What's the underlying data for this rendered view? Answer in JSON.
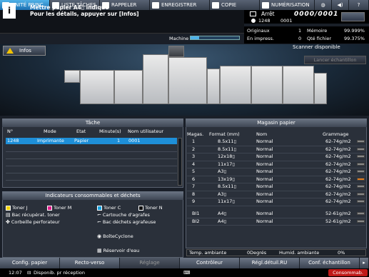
{
  "tabs": [
    {
      "label": "UNITÉ PRINC.",
      "active": true,
      "icon": "home-icon"
    },
    {
      "label": "LISTE TÂCHES",
      "active": false,
      "icon": "list-icon"
    },
    {
      "label": "RAPPELER",
      "active": false,
      "icon": "recall-icon"
    },
    {
      "label": "ENREGISTRER",
      "active": false,
      "icon": "save-icon"
    },
    {
      "label": "COPIE",
      "active": false,
      "icon": "copy-icon"
    },
    {
      "label": "NUMÉRISATION",
      "active": false,
      "icon": "scan-icon"
    }
  ],
  "top_icons": [
    "globe-icon",
    "speaker-icon",
    "help-icon"
  ],
  "message": {
    "line1": "Mettre papier  A4▯     indiqué",
    "line2": "Pour les détails, appuyer sur [Infos]"
  },
  "status": {
    "state": "Arrêt",
    "counter": "0000/0001",
    "user_id": "1248",
    "user_sub": "0001"
  },
  "stats": {
    "originaux_label": "Originaux",
    "originaux_value": "1",
    "en_impress_label": "En impress.",
    "en_impress_value": "0",
    "memoire_label": "Mémoire",
    "memoire_value": "99.999%",
    "qte_fichier_label": "Qté fichier",
    "qte_fichier_value": "99.375%"
  },
  "machine": {
    "label": "Machine",
    "progress_pct": 15
  },
  "infos_button": "Infos",
  "scanner_status": "Scanner disponible",
  "lancer_button": "Lancer échantillon",
  "tache": {
    "title": "Tâche",
    "columns": [
      "N°",
      "Mode",
      "Etat",
      "Minute(s)",
      "Nom utilisateur"
    ],
    "rows": [
      {
        "n": "1248",
        "mode": "Imprimante",
        "etat": "Papier",
        "minutes": "1",
        "user": "0001"
      }
    ]
  },
  "indicateurs": {
    "title": "Indicateurs consommables et déchets",
    "toners": [
      {
        "label": "Toner J",
        "color": "#f5d300"
      },
      {
        "label": "Toner M",
        "color": "#e0208c"
      },
      {
        "label": "Toner C",
        "color": "#1aa3e0"
      },
      {
        "label": "Toner N",
        "color": "#111111"
      }
    ],
    "items": [
      "Bac récupérat. toner",
      "Cartouche d'agrafes",
      "Corbeille perforateur",
      "Bac déchets agrafeuse",
      "BoîteCyclone",
      "Réservoir d'eau"
    ]
  },
  "magasin": {
    "title": "Magasin papier",
    "columns": [
      "Magas.",
      "Format (mm)",
      "Nom",
      "Grammage"
    ],
    "rows": [
      {
        "mag": "1",
        "format": "8.5x11▯",
        "nom": "Normal",
        "gram": "62-74g/m2",
        "warn": false
      },
      {
        "mag": "2",
        "format": "8.5x11▯",
        "nom": "Normal",
        "gram": "62-74g/m2",
        "warn": false
      },
      {
        "mag": "3",
        "format": "12x18▯",
        "nom": "Normal",
        "gram": "62-74g/m2",
        "warn": false
      },
      {
        "mag": "4",
        "format": "11x17▯",
        "nom": "Normal",
        "gram": "62-74g/m2",
        "warn": false
      },
      {
        "mag": "5",
        "format": "A3▯",
        "nom": "Normal",
        "gram": "62-74g/m2",
        "warn": false
      },
      {
        "mag": "6",
        "format": "13x19▯",
        "nom": "Normal",
        "gram": "62-74g/m2",
        "warn": true
      },
      {
        "mag": "7",
        "format": "8.5x11▯",
        "nom": "Normal",
        "gram": "62-74g/m2",
        "warn": false
      },
      {
        "mag": "8",
        "format": "A3▯",
        "nom": "Normal",
        "gram": "62-74g/m2",
        "warn": false
      },
      {
        "mag": "9",
        "format": "11x17▯",
        "nom": "Normal",
        "gram": "62-74g/m2",
        "warn": false
      }
    ],
    "rows_bi": [
      {
        "mag": "BI1",
        "format": "A4▯",
        "nom": "Normal",
        "gram": "52-61g/m2"
      },
      {
        "mag": "BI2",
        "format": "A4▯",
        "nom": "Normal",
        "gram": "52-61g/m2"
      }
    ],
    "temp_label": "Temp. ambiante",
    "temp_value": "0Degrés",
    "humid_label": "Humid. ambiante",
    "humid_value": "0%"
  },
  "bottom_buttons": [
    {
      "label": "Config. papier",
      "enabled": true
    },
    {
      "label": "Recto-verso",
      "enabled": true
    },
    {
      "label": "Réglage",
      "enabled": false
    },
    {
      "label": "Contrôleur",
      "enabled": true
    },
    {
      "label": "Régl.détuil.RU",
      "enabled": true
    },
    {
      "label": "Conf. échantillon",
      "enabled": true
    }
  ],
  "footer": {
    "time": "12:07",
    "status": "Disponib. pr réception",
    "consumables": "Consommab."
  }
}
